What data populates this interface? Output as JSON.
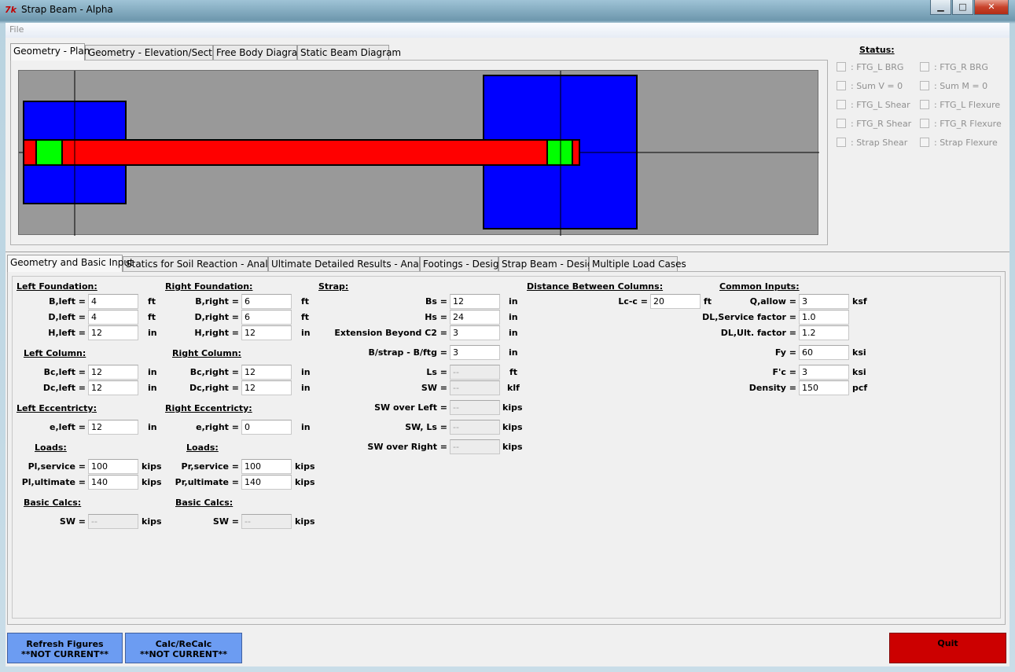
{
  "window": {
    "title": "Strap Beam - Alpha",
    "icon_text": "7k",
    "buttons": {
      "minimize": "▁",
      "maximize": "□",
      "close": "✕"
    }
  },
  "menu": {
    "file": "File"
  },
  "top_tabs": [
    "Geometry - Plan",
    "Geometry - Elevation/Section",
    "Free Body Diagram",
    "Static Beam Diagram"
  ],
  "status": {
    "title": "Status:",
    "checks": [
      {
        "label": ": FTG_L BRG",
        "checked": false
      },
      {
        "label": ": FTG_R BRG",
        "checked": false
      },
      {
        "label": ": Sum V = 0",
        "checked": false
      },
      {
        "label": ": Sum M = 0",
        "checked": false
      },
      {
        "label": ": FTG_L Shear",
        "checked": false
      },
      {
        "label": ": FTG_L Flexure",
        "checked": false
      },
      {
        "label": ": FTG_R Shear",
        "checked": false
      },
      {
        "label": ": FTG_R Flexure",
        "checked": false
      },
      {
        "label": ": Strap Shear",
        "checked": false
      },
      {
        "label": ": Strap Flexure",
        "checked": false
      }
    ]
  },
  "plan_colors": {
    "background": "#999999",
    "footing": "#0000ff",
    "strap": "#ff0000",
    "column": "#00ff00",
    "axis": "#000000"
  },
  "bottom_tabs": [
    "Geometry and Basic Input",
    "Statics for Soil Reaction - Analysis",
    "Ultimate Detailed Results - Analysis",
    "Footings - Design",
    "Strap Beam - Design",
    "Multiple Load Cases"
  ],
  "left": {
    "foundation_title": "Left Foundation:",
    "b_label": "B,left =",
    "b_value": "4",
    "b_unit": "ft",
    "d_label": "D,left =",
    "d_value": "4",
    "d_unit": "ft",
    "h_label": "H,left =",
    "h_value": "12",
    "h_unit": "in",
    "column_title": "Left Column:",
    "bc_label": "Bc,left =",
    "bc_value": "12",
    "bc_unit": "in",
    "dc_label": "Dc,left =",
    "dc_value": "12",
    "dc_unit": "in",
    "ecc_title": "Left Eccentricty:",
    "e_label": "e,left =",
    "e_value": "12",
    "e_unit": "in",
    "loads_title": "Loads:",
    "ps_label": "Pl,service =",
    "ps_value": "100",
    "ps_unit": "kips",
    "pu_label": "Pl,ultimate =",
    "pu_value": "140",
    "pu_unit": "kips",
    "calcs_title": "Basic Calcs:",
    "sw_label": "SW =",
    "sw_value": "--",
    "sw_unit": "kips"
  },
  "right": {
    "foundation_title": "Right Foundation:",
    "b_label": "B,right =",
    "b_value": "6",
    "b_unit": "ft",
    "d_label": "D,right =",
    "d_value": "6",
    "d_unit": "ft",
    "h_label": "H,right =",
    "h_value": "12",
    "h_unit": "in",
    "column_title": "Right Column:",
    "bc_label": "Bc,right =",
    "bc_value": "12",
    "bc_unit": "in",
    "dc_label": "Dc,right =",
    "dc_value": "12",
    "dc_unit": "in",
    "ecc_title": "Right Eccentricty:",
    "e_label": "e,right =",
    "e_value": "0",
    "e_unit": "in",
    "loads_title": "Loads:",
    "ps_label": "Pr,service =",
    "ps_value": "100",
    "ps_unit": "kips",
    "pu_label": "Pr,ultimate =",
    "pu_value": "140",
    "pu_unit": "kips",
    "calcs_title": "Basic Calcs:",
    "sw_label": "SW =",
    "sw_value": "--",
    "sw_unit": "kips"
  },
  "strap": {
    "title": "Strap:",
    "bs_label": "Bs =",
    "bs_value": "12",
    "bs_unit": "in",
    "hs_label": "Hs =",
    "hs_value": "24",
    "hs_unit": "in",
    "ext_label": "Extension Beyond C2 =",
    "ext_value": "3",
    "ext_unit": "in",
    "bdiff_label": "B/strap - B/ftg =",
    "bdiff_value": "3",
    "bdiff_unit": "in",
    "ls_label": "Ls =",
    "ls_value": "--",
    "ls_unit": "ft",
    "sw_label": "SW =",
    "sw_value": "--",
    "sw_unit": "klf",
    "swl_label": "SW over Left =",
    "swl_value": "--",
    "swl_unit": "kips",
    "swls_label": "SW, Ls =",
    "swls_value": "--",
    "swls_unit": "kips",
    "swr_label": "SW over Right =",
    "swr_value": "--",
    "swr_unit": "kips"
  },
  "distance": {
    "title": "Distance Between Columns:",
    "lcc_label": "Lc-c =",
    "lcc_value": "20",
    "lcc_unit": "ft"
  },
  "common": {
    "title": "Common Inputs:",
    "q_label": "Q,allow =",
    "q_value": "3",
    "q_unit": "ksf",
    "dls_label": "DL,Service factor =",
    "dls_value": "1.0",
    "dlu_label": "DL,Ult. factor =",
    "dlu_value": "1.2",
    "fy_label": "Fy =",
    "fy_value": "60",
    "fy_unit": "ksi",
    "fc_label": "F'c =",
    "fc_value": "3",
    "fc_unit": "ksi",
    "dens_label": "Density =",
    "dens_value": "150",
    "dens_unit": "pcf"
  },
  "buttons": {
    "refresh_line1": "Refresh Figures",
    "refresh_line2": "**NOT CURRENT**",
    "calc_line1": "Calc/ReCalc",
    "calc_line2": "**NOT CURRENT**",
    "quit": "Quit",
    "blue": "#6c9cf2",
    "red": "#cc0000"
  }
}
